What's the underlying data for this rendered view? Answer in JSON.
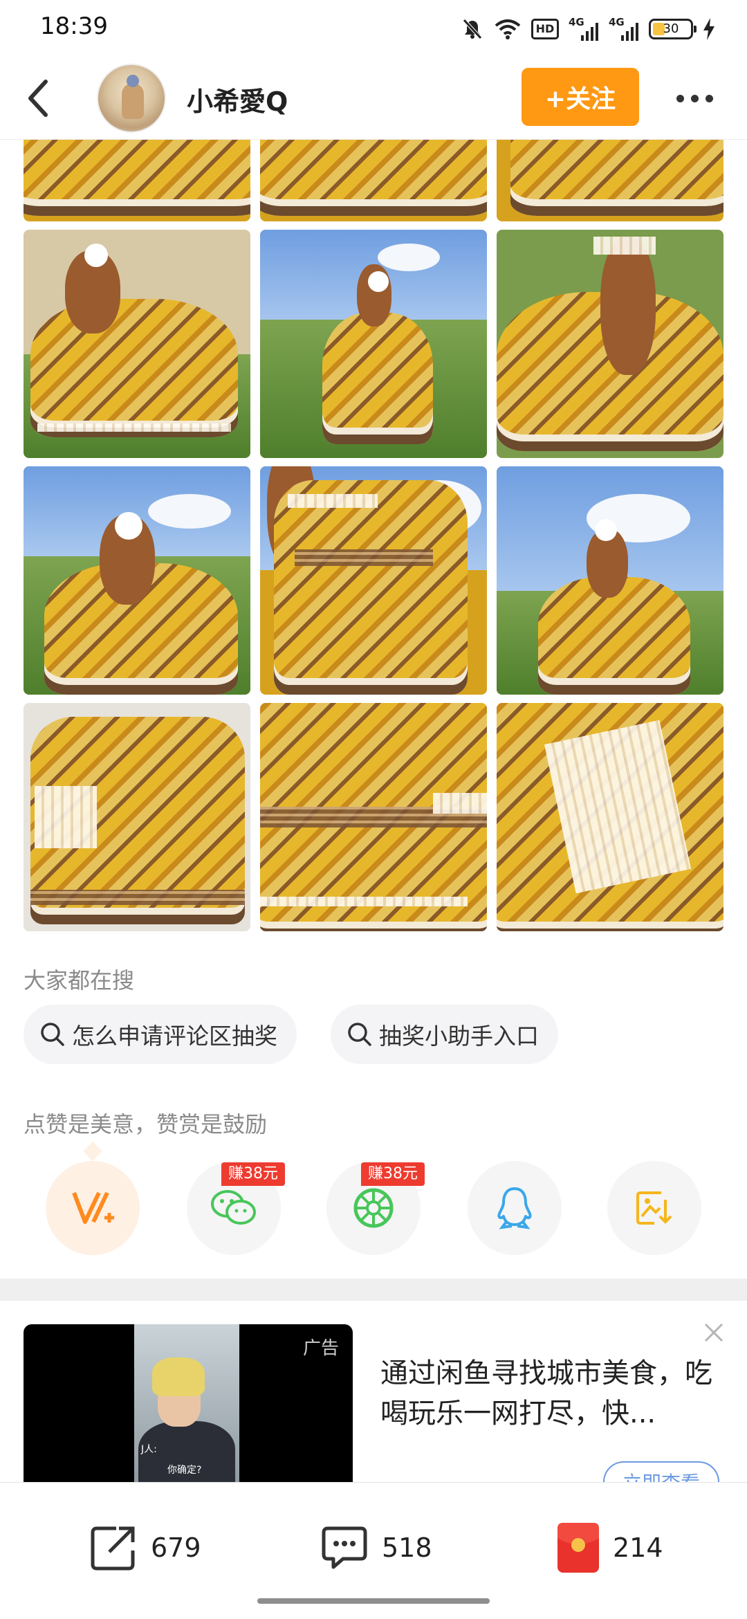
{
  "status_bar": {
    "time": "18:39",
    "network_1": "4G",
    "network_2": "4G",
    "battery": "30",
    "hd_label": "HD"
  },
  "header": {
    "username": "小希愛Q",
    "follow_label": "+关注"
  },
  "search_section": {
    "title": "大家都在搜",
    "queries": [
      "怎么申请评论区抽奖",
      "抽奖小助手入口"
    ]
  },
  "praise_section": {
    "title": "点赞是美意，赞赏是鼓励",
    "share_targets": [
      {
        "name": "v-plus-praise-icon",
        "badge": ""
      },
      {
        "name": "wechat-icon",
        "badge": "赚38元"
      },
      {
        "name": "wechat-moments-icon",
        "badge": "赚38元"
      },
      {
        "name": "qq-icon",
        "badge": ""
      },
      {
        "name": "save-image-icon",
        "badge": ""
      }
    ]
  },
  "ad": {
    "label": "广告",
    "title": "通过闲鱼寻找城市美食，吃喝玩乐一网打尽，快...",
    "cta": "立即查看",
    "video_subtitle_1": "J人:",
    "video_subtitle_2": "你确定?"
  },
  "bottom_bar": {
    "share_count": "679",
    "comment_count": "518",
    "reward_count": "214"
  },
  "colors": {
    "accent": "#ff9812",
    "earn_badge": "#ee3b2f",
    "cta_blue": "#6c9ae0",
    "wechat_green": "#48c65a",
    "qq_blue": "#3aa7ea",
    "praise_orange": "#ff8a1e"
  }
}
